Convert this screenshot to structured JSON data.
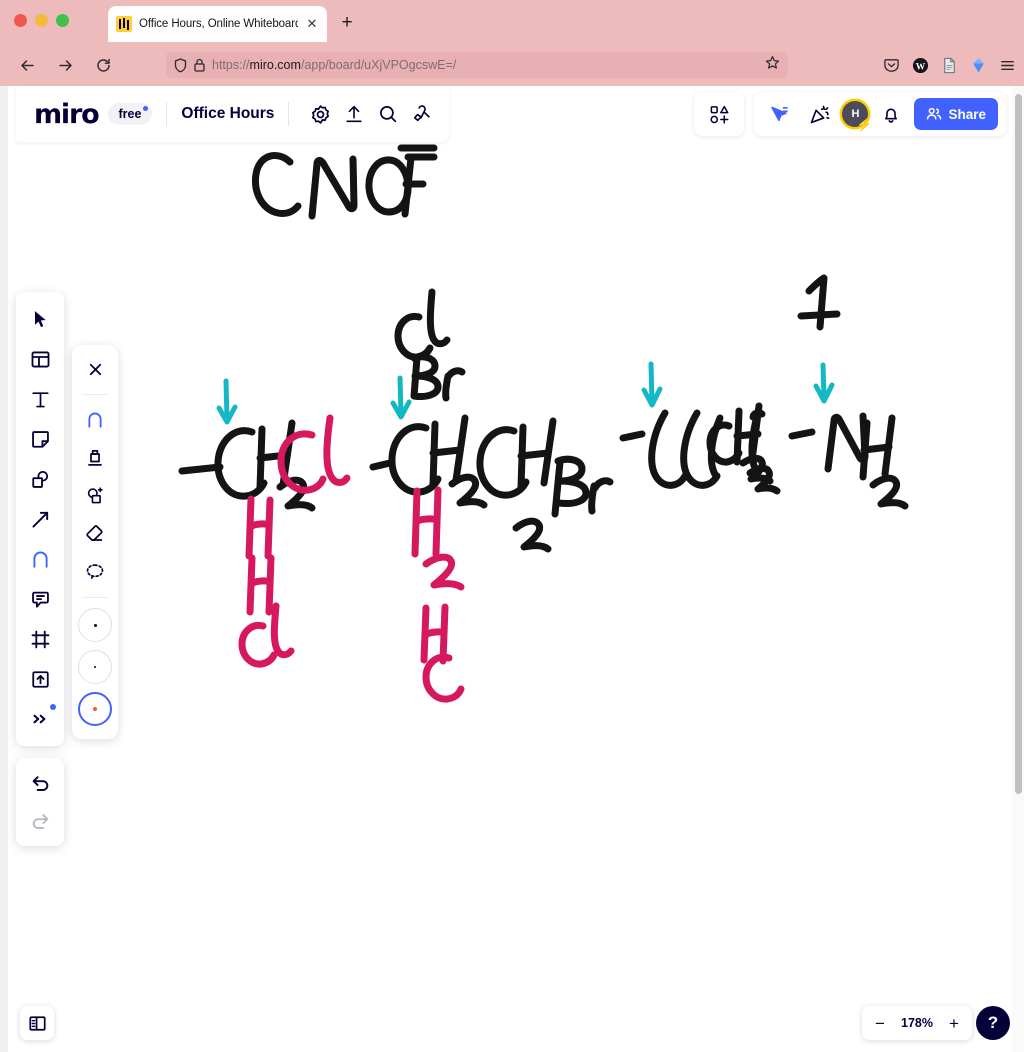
{
  "browser": {
    "tab": {
      "title": "Office Hours, Online Whiteboard",
      "close_label": "✕",
      "favicon_name": "miro-favicon"
    },
    "new_tab_label": "+",
    "url": {
      "domain": "miro.com",
      "path": "/app/board/uXjVPOgcswE=/",
      "scheme": "https://"
    },
    "nav": {
      "back_label": "Back",
      "forward_label": "Forward",
      "reload_label": "Reload"
    },
    "extensions": [
      "pocket-icon",
      "wikipedia-icon",
      "document-icon",
      "gem-icon",
      "menu-icon"
    ]
  },
  "app": {
    "logo_text": "miro",
    "plan_badge": "free",
    "board_title": "Office Hours",
    "header_icons": [
      {
        "name": "settings-icon",
        "label": "Settings"
      },
      {
        "name": "upload-icon",
        "label": "Upload"
      },
      {
        "name": "search-icon",
        "label": "Search"
      },
      {
        "name": "apps-icon",
        "label": "Apps"
      }
    ],
    "header_right": {
      "templates_label": "Templates",
      "presentation_label": "Presentation mode",
      "celebrate_label": "Celebrate",
      "avatar_initial": "H",
      "notifications_label": "Notifications",
      "share_label": "Share"
    },
    "accent_color": "#4262ff",
    "brand_color": "#050038",
    "badge_color": "#ffce00"
  },
  "toolbar": {
    "items": [
      {
        "name": "tool-select",
        "label": "Select",
        "active": false
      },
      {
        "name": "tool-templates",
        "label": "Templates",
        "active": false
      },
      {
        "name": "tool-text",
        "label": "Text",
        "active": false
      },
      {
        "name": "tool-sticky-note",
        "label": "Sticky note",
        "active": false
      },
      {
        "name": "tool-shapes",
        "label": "Shapes",
        "active": false
      },
      {
        "name": "tool-connector",
        "label": "Connection line",
        "active": false
      },
      {
        "name": "tool-pen",
        "label": "Pen",
        "active": true
      },
      {
        "name": "tool-comment",
        "label": "Comment",
        "active": false
      },
      {
        "name": "tool-frame",
        "label": "Frame",
        "active": false
      },
      {
        "name": "tool-upload",
        "label": "Upload",
        "active": false
      },
      {
        "name": "tool-more",
        "label": "More tools",
        "active": false
      }
    ],
    "undo_label": "Undo",
    "redo_label": "Redo"
  },
  "pen_panel": {
    "close_label": "✕",
    "items": [
      {
        "name": "pen-tool-pen",
        "label": "Pen",
        "active": true
      },
      {
        "name": "pen-tool-marker",
        "label": "Marker",
        "active": false
      },
      {
        "name": "pen-tool-smart-draw",
        "label": "Smart drawing",
        "active": false
      },
      {
        "name": "pen-tool-eraser",
        "label": "Eraser",
        "active": false
      },
      {
        "name": "pen-tool-lasso",
        "label": "Lasso select",
        "active": false
      }
    ],
    "strokes": [
      {
        "name": "stroke-small",
        "size": 3,
        "selected": false
      },
      {
        "name": "stroke-medium",
        "size": 4,
        "selected": false
      },
      {
        "name": "stroke-large",
        "size": 5,
        "selected": true
      }
    ]
  },
  "footer": {
    "panel_toggle_label": "Toggle panel",
    "zoom_out_label": "−",
    "zoom_level": "178%",
    "zoom_in_label": "+",
    "help_label": "?"
  },
  "whiteboard": {
    "ink_colors": {
      "black": "#141414",
      "pink": "#d6185e",
      "teal": "#14b8c4"
    },
    "annotations": [
      {
        "name": "element-list",
        "text": "C N O F Cl Br",
        "color": "black"
      },
      {
        "name": "page-number",
        "text": "1",
        "color": "black"
      },
      {
        "name": "group-1-formula",
        "text": "—CH2Cl",
        "color": "black"
      },
      {
        "name": "group-1-expanded",
        "text": "H H Cl",
        "color": "pink"
      },
      {
        "name": "group-2-formula",
        "text": "—CH2CH2Br",
        "color": "black"
      },
      {
        "name": "group-2-expanded",
        "text": "H H C",
        "color": "pink"
      },
      {
        "name": "group-3-formula",
        "text": "—C(CH3)3",
        "color": "black"
      },
      {
        "name": "group-4-formula",
        "text": "—NH2",
        "color": "black"
      },
      {
        "name": "arrow-1",
        "text": "↓",
        "color": "teal"
      },
      {
        "name": "arrow-2",
        "text": "↓",
        "color": "teal"
      },
      {
        "name": "arrow-3",
        "text": "↓",
        "color": "teal"
      },
      {
        "name": "arrow-4",
        "text": "↓",
        "color": "teal"
      }
    ]
  }
}
